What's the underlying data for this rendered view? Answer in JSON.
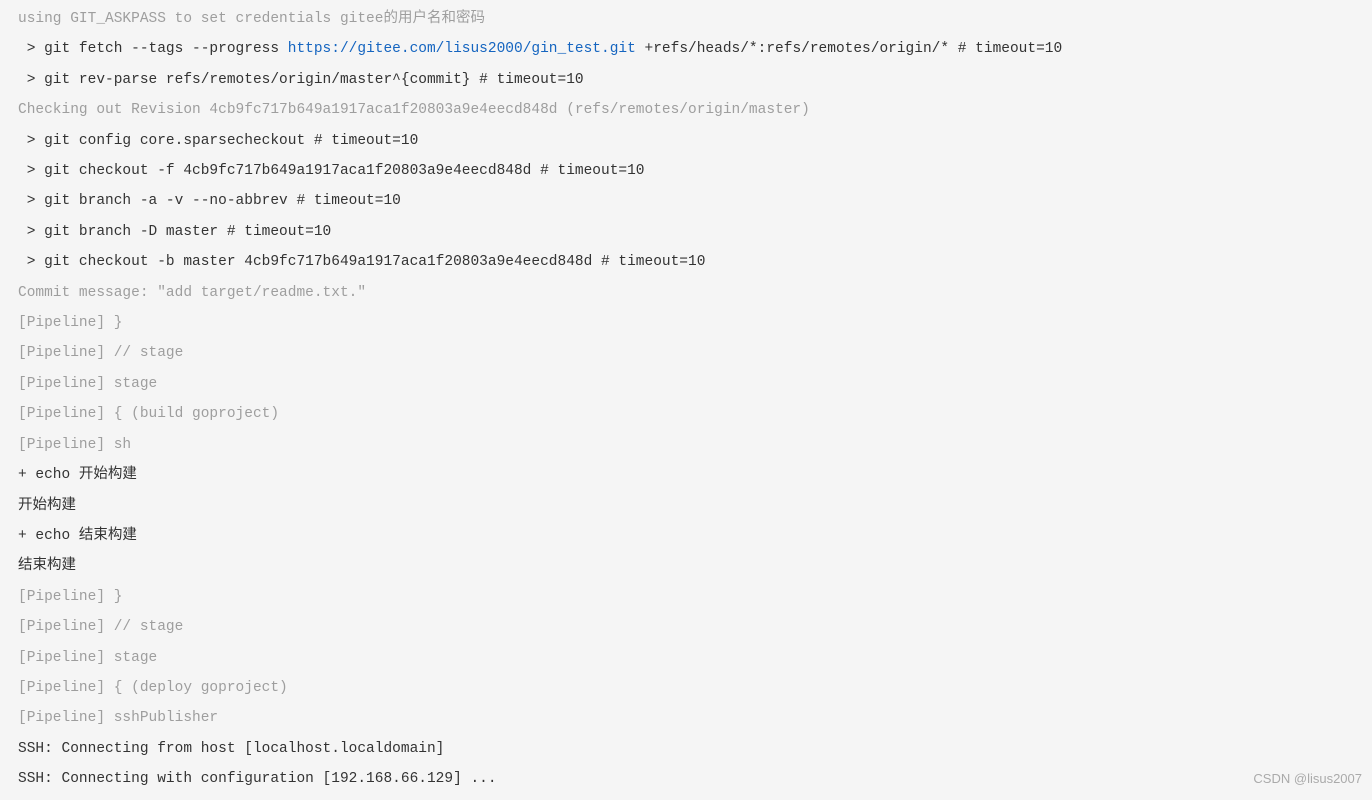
{
  "lines": [
    {
      "type": "dim",
      "segments": [
        {
          "t": "text",
          "v": "using GIT_ASKPASS to set credentials gitee的用户名和密码"
        }
      ]
    },
    {
      "type": "normal",
      "segments": [
        {
          "t": "text",
          "v": " > git fetch --tags --progress "
        },
        {
          "t": "link",
          "v": "https://gitee.com/lisus2000/gin_test.git"
        },
        {
          "t": "text",
          "v": " +refs/heads/*:refs/remotes/origin/* # timeout=10"
        }
      ]
    },
    {
      "type": "normal",
      "segments": [
        {
          "t": "text",
          "v": " > git rev-parse refs/remotes/origin/master^{commit} # timeout=10"
        }
      ]
    },
    {
      "type": "dim",
      "segments": [
        {
          "t": "text",
          "v": "Checking out Revision 4cb9fc717b649a1917aca1f20803a9e4eecd848d (refs/remotes/origin/master)"
        }
      ]
    },
    {
      "type": "normal",
      "segments": [
        {
          "t": "text",
          "v": " > git config core.sparsecheckout # timeout=10"
        }
      ]
    },
    {
      "type": "normal",
      "segments": [
        {
          "t": "text",
          "v": " > git checkout -f 4cb9fc717b649a1917aca1f20803a9e4eecd848d # timeout=10"
        }
      ]
    },
    {
      "type": "normal",
      "segments": [
        {
          "t": "text",
          "v": " > git branch -a -v --no-abbrev # timeout=10"
        }
      ]
    },
    {
      "type": "normal",
      "segments": [
        {
          "t": "text",
          "v": " > git branch -D master # timeout=10"
        }
      ]
    },
    {
      "type": "normal",
      "segments": [
        {
          "t": "text",
          "v": " > git checkout -b master 4cb9fc717b649a1917aca1f20803a9e4eecd848d # timeout=10"
        }
      ]
    },
    {
      "type": "dim",
      "segments": [
        {
          "t": "text",
          "v": "Commit message: \"add target/readme.txt.\""
        }
      ]
    },
    {
      "type": "dim",
      "segments": [
        {
          "t": "text",
          "v": "[Pipeline] }"
        }
      ]
    },
    {
      "type": "dim",
      "segments": [
        {
          "t": "text",
          "v": "[Pipeline] // stage"
        }
      ]
    },
    {
      "type": "dim",
      "segments": [
        {
          "t": "text",
          "v": "[Pipeline] stage"
        }
      ]
    },
    {
      "type": "dim",
      "segments": [
        {
          "t": "text",
          "v": "[Pipeline] { (build goproject)"
        }
      ]
    },
    {
      "type": "dim",
      "segments": [
        {
          "t": "text",
          "v": "[Pipeline] sh"
        }
      ]
    },
    {
      "type": "normal",
      "segments": [
        {
          "t": "text",
          "v": "+ echo 开始构建"
        }
      ]
    },
    {
      "type": "normal",
      "segments": [
        {
          "t": "text",
          "v": "开始构建"
        }
      ]
    },
    {
      "type": "normal",
      "segments": [
        {
          "t": "text",
          "v": "+ echo 结束构建"
        }
      ]
    },
    {
      "type": "normal",
      "segments": [
        {
          "t": "text",
          "v": "结束构建"
        }
      ]
    },
    {
      "type": "dim",
      "segments": [
        {
          "t": "text",
          "v": "[Pipeline] }"
        }
      ]
    },
    {
      "type": "dim",
      "segments": [
        {
          "t": "text",
          "v": "[Pipeline] // stage"
        }
      ]
    },
    {
      "type": "dim",
      "segments": [
        {
          "t": "text",
          "v": "[Pipeline] stage"
        }
      ]
    },
    {
      "type": "dim",
      "segments": [
        {
          "t": "text",
          "v": "[Pipeline] { (deploy goproject)"
        }
      ]
    },
    {
      "type": "dim",
      "segments": [
        {
          "t": "text",
          "v": "[Pipeline] sshPublisher"
        }
      ]
    },
    {
      "type": "normal",
      "segments": [
        {
          "t": "text",
          "v": "SSH: Connecting from host [localhost.localdomain]"
        }
      ]
    },
    {
      "type": "normal",
      "segments": [
        {
          "t": "text",
          "v": "SSH: Connecting with configuration [192.168.66.129] ..."
        }
      ]
    }
  ],
  "watermark": "CSDN @lisus2007"
}
